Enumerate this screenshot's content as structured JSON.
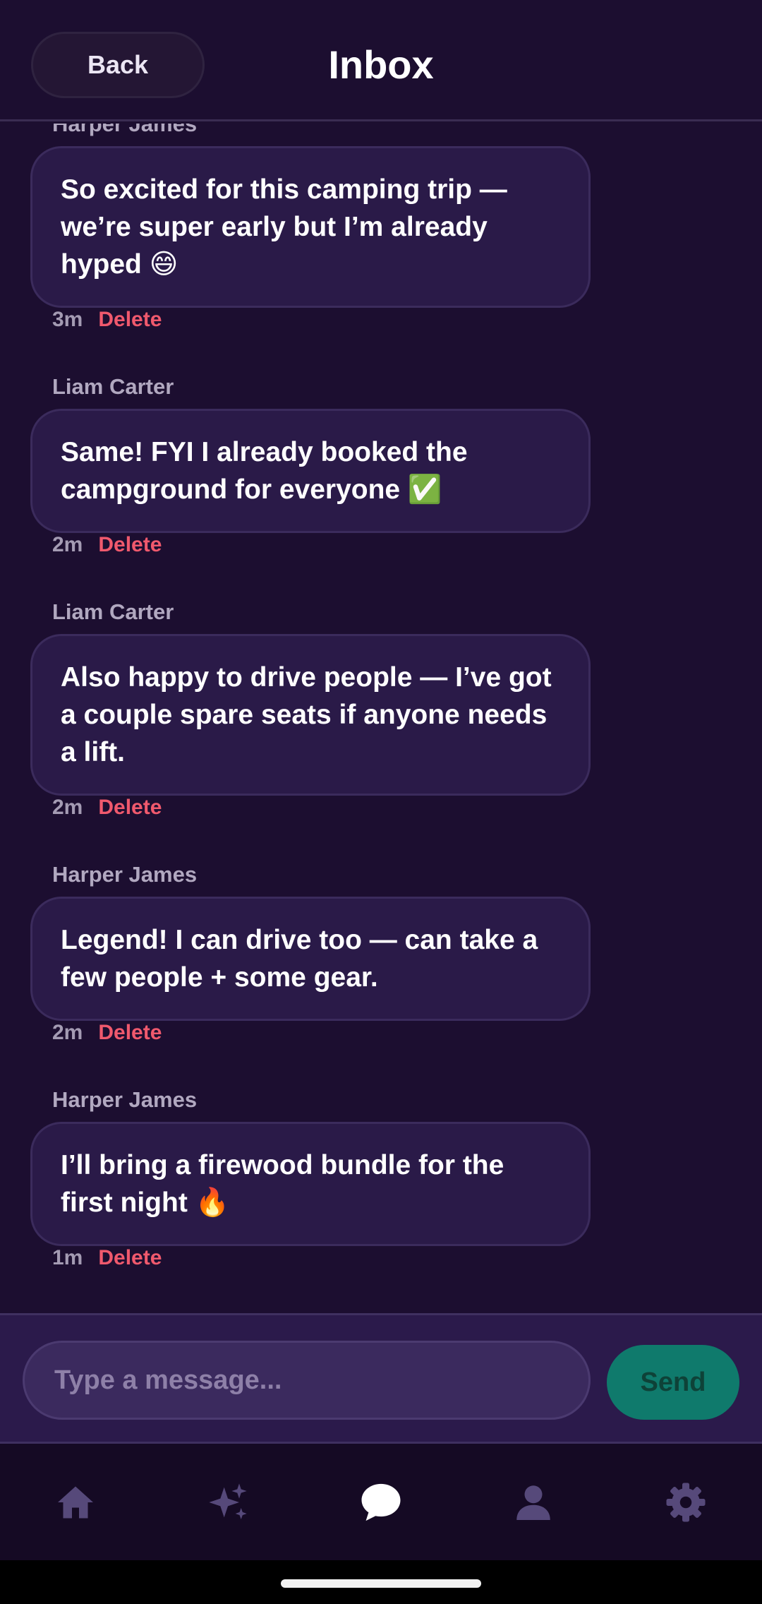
{
  "header": {
    "back_label": "Back",
    "title": "Inbox"
  },
  "messages": [
    {
      "sender": "Harper James",
      "text": "So excited for this camping trip — we’re super early but I’m already hyped 😄",
      "time": "3m",
      "delete_label": "Delete"
    },
    {
      "sender": "Liam Carter",
      "text": "Same! FYI I already booked the campground for everyone ✅",
      "time": "2m",
      "delete_label": "Delete"
    },
    {
      "sender": "Liam Carter",
      "text": "Also happy to drive people — I’ve got a couple spare seats if anyone needs a lift.",
      "time": "2m",
      "delete_label": "Delete"
    },
    {
      "sender": "Harper James",
      "text": "Legend! I can drive too — can take a few people + some gear.",
      "time": "2m",
      "delete_label": "Delete"
    },
    {
      "sender": "Harper James",
      "text": "I’ll bring a firewood bundle for the first night 🔥",
      "time": "1m",
      "delete_label": "Delete"
    }
  ],
  "composer": {
    "placeholder": "Type a message...",
    "send_label": "Send"
  },
  "nav": {
    "items": [
      {
        "icon": "home-icon"
      },
      {
        "icon": "sparkles-icon"
      },
      {
        "icon": "chat-icon",
        "active": true
      },
      {
        "icon": "profile-icon"
      },
      {
        "icon": "gear-icon"
      }
    ]
  },
  "colors": {
    "background": "#1c0e30",
    "bubble": "#2a1a48",
    "delete": "#f0596d",
    "send": "#0f7a6c"
  }
}
